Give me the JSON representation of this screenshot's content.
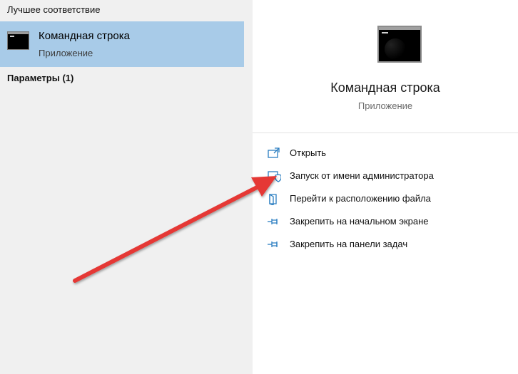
{
  "best_match": {
    "header": "Лучшее соответствие",
    "item": {
      "title": "Командная строка",
      "subtitle": "Приложение",
      "icon": "command-prompt-icon"
    }
  },
  "settings": {
    "header": "Параметры (1)"
  },
  "details": {
    "title": "Командная строка",
    "subtitle": "Приложение",
    "icon": "command-prompt-icon",
    "actions": [
      {
        "label": "Открыть",
        "icon": "open-icon"
      },
      {
        "label": "Запуск от имени администратора",
        "icon": "run-as-admin-shield-icon"
      },
      {
        "label": "Перейти к расположению файла",
        "icon": "file-location-icon"
      },
      {
        "label": "Закрепить на начальном экране",
        "icon": "pin-icon"
      },
      {
        "label": "Закрепить на панели задач",
        "icon": "pin-icon"
      }
    ]
  },
  "colors": {
    "selection": "#a8cbe8",
    "accent": "#2b7ec1",
    "arrow": "#e53935"
  }
}
